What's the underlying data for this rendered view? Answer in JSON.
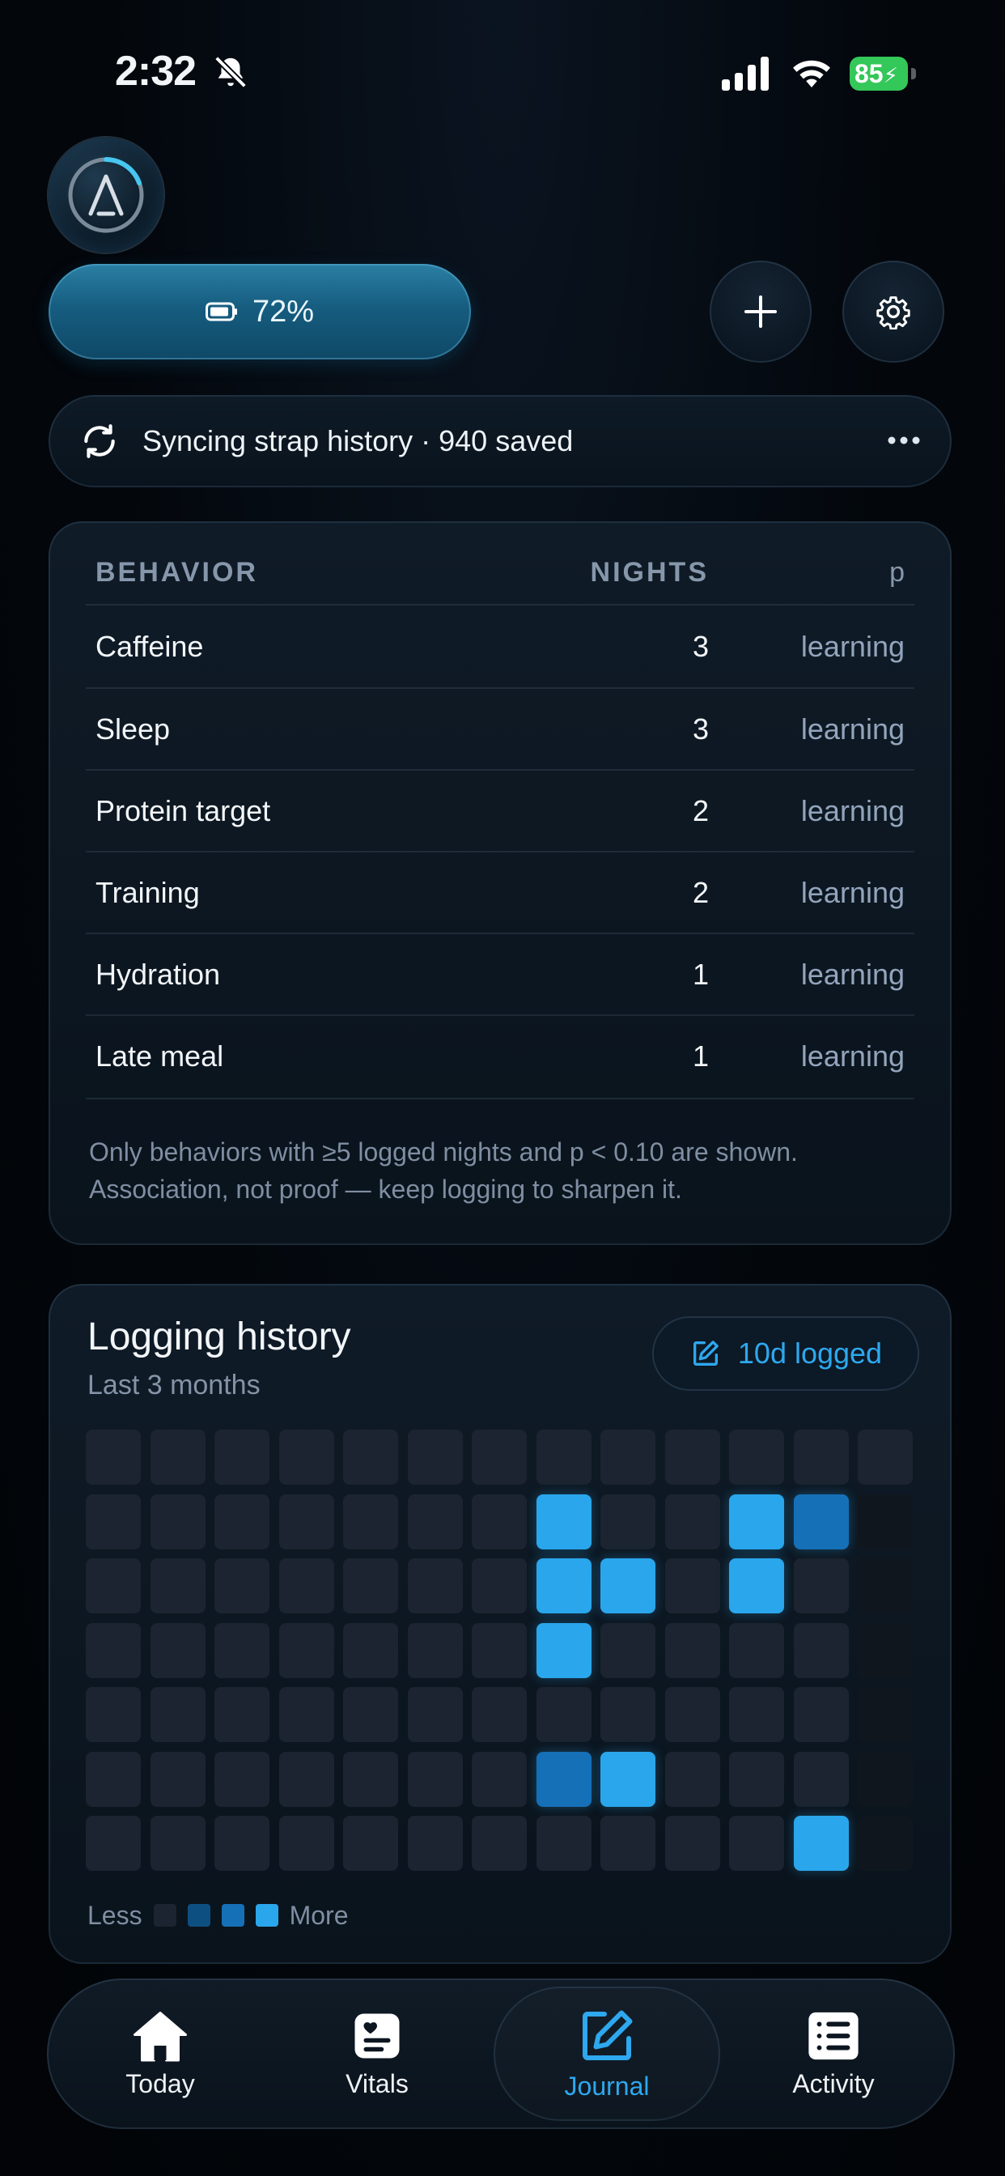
{
  "status_bar": {
    "time": "2:32",
    "battery": "85"
  },
  "device": {
    "battery_label": "72%"
  },
  "sync": {
    "text": "Syncing strap history · 940 saved"
  },
  "behavior_table": {
    "headers": {
      "behavior": "BEHAVIOR",
      "nights": "NIGHTS",
      "p": "p"
    },
    "rows": [
      {
        "name": "Caffeine",
        "nights": "3",
        "p": "learning"
      },
      {
        "name": "Sleep",
        "nights": "3",
        "p": "learning"
      },
      {
        "name": "Protein target",
        "nights": "2",
        "p": "learning"
      },
      {
        "name": "Training",
        "nights": "2",
        "p": "learning"
      },
      {
        "name": "Hydration",
        "nights": "1",
        "p": "learning"
      },
      {
        "name": "Late meal",
        "nights": "1",
        "p": "learning"
      }
    ],
    "footnote": "Only behaviors with ≥5 logged nights and p < 0.10 are shown. Association, not proof — keep logging to sharpen it."
  },
  "history": {
    "title": "Logging history",
    "subtitle": "Last 3 months",
    "badge": "10d logged",
    "legend_less": "Less",
    "legend_more": "More",
    "colors": {
      "empty": "#1b2430",
      "dim": "#0f161e",
      "level1": "#0e4f82",
      "level2": "#1670b8",
      "level3": "#2aa6ec"
    },
    "weeks": 13,
    "days": 7,
    "grid": [
      [
        0,
        0,
        0,
        0,
        0,
        0,
        0,
        0,
        0,
        0,
        0,
        0,
        0
      ],
      [
        0,
        0,
        0,
        0,
        0,
        0,
        0,
        3,
        0,
        0,
        3,
        2,
        -1
      ],
      [
        0,
        0,
        0,
        0,
        0,
        0,
        0,
        3,
        3,
        0,
        3,
        0,
        -1
      ],
      [
        0,
        0,
        0,
        0,
        0,
        0,
        0,
        3,
        0,
        0,
        0,
        0,
        -1
      ],
      [
        0,
        0,
        0,
        0,
        0,
        0,
        0,
        0,
        0,
        0,
        0,
        0,
        -1
      ],
      [
        0,
        0,
        0,
        0,
        0,
        0,
        0,
        2,
        3,
        0,
        0,
        0,
        -1
      ],
      [
        0,
        0,
        0,
        0,
        0,
        0,
        0,
        0,
        0,
        0,
        0,
        3,
        -1
      ]
    ]
  },
  "tabs": [
    {
      "label": "Today",
      "icon": "home-icon"
    },
    {
      "label": "Vitals",
      "icon": "vitals-icon"
    },
    {
      "label": "Journal",
      "icon": "journal-icon",
      "active": true
    },
    {
      "label": "Activity",
      "icon": "activity-icon"
    }
  ]
}
